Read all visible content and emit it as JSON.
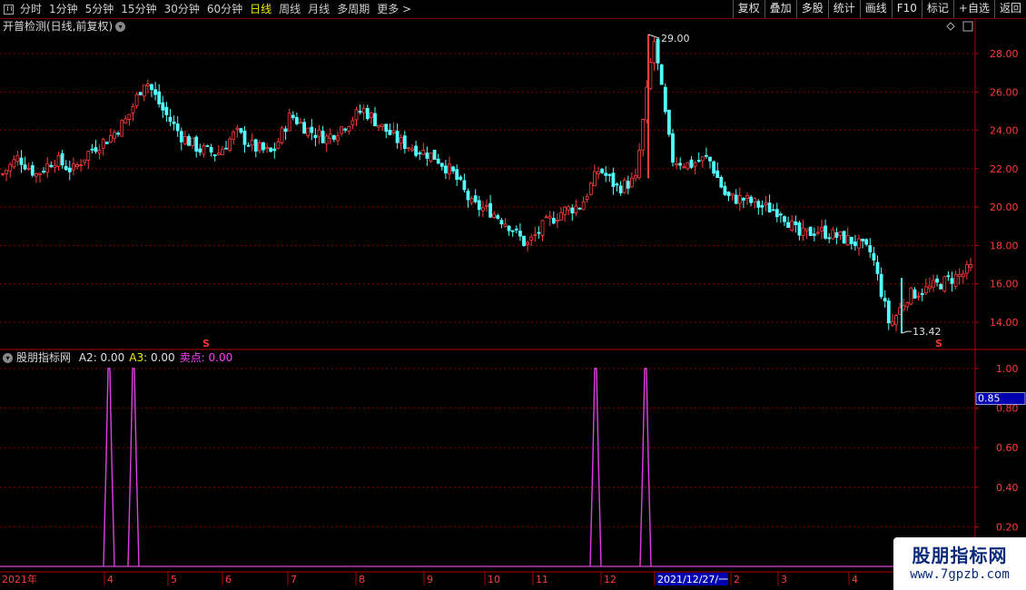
{
  "toolbar": {
    "periods": [
      "分时",
      "1分钟",
      "5分钟",
      "15分钟",
      "30分钟",
      "60分钟",
      "日线",
      "周线",
      "月线",
      "多周期",
      "更多"
    ],
    "active_period": "日线",
    "right_buttons": [
      "复权",
      "叠加",
      "多股",
      "统计",
      "画线",
      "F10",
      "标记",
      "+自选",
      "返回"
    ]
  },
  "main_panel": {
    "title": "开普检测(日线,前复权)",
    "high_label": "29.00",
    "low_label": "13.42",
    "sell_marker": "S",
    "y_ticks": [
      "28.00",
      "26.00",
      "24.00",
      "22.00",
      "20.00",
      "18.00",
      "16.00",
      "14.00"
    ]
  },
  "indicator_panel": {
    "name": "股朋指标网",
    "fields": [
      {
        "label": "A2:",
        "value": "0.00",
        "color": "#e0e0e0"
      },
      {
        "label": "A3:",
        "value": "0.00",
        "color": "#f0f000"
      },
      {
        "label": "卖点:",
        "value": "0.00",
        "color": "#ff40ff"
      }
    ],
    "y_ticks": [
      "1.00",
      "0.80",
      "0.60",
      "0.40",
      "0.20"
    ],
    "cursor_value": "0.85"
  },
  "time_axis": {
    "labels": [
      "2021年",
      "4",
      "5",
      "6",
      "7",
      "8",
      "9",
      "10",
      "11",
      "12",
      "2021/12/27/一",
      "2",
      "3",
      "4"
    ]
  },
  "colors": {
    "up": "#ff3c3c",
    "down": "#54ffff",
    "grid": "#8b0000",
    "indicator_line": "#e040e0"
  },
  "chart_data": {
    "type": "line",
    "y_range_price": [
      13.0,
      29.0
    ],
    "price_high": 29.0,
    "price_low": 13.42,
    "indicator_ylim": [
      0,
      1
    ],
    "x": [
      0,
      20,
      40,
      60,
      80,
      100,
      120,
      140,
      160,
      180,
      200,
      220,
      240,
      260,
      280,
      300,
      320,
      340,
      360,
      380,
      400,
      420,
      440,
      460,
      480,
      500,
      520,
      540,
      560,
      580,
      600,
      620,
      640,
      660,
      680,
      700,
      720,
      740,
      760,
      780,
      800,
      820,
      840,
      860,
      880,
      900,
      920,
      940,
      960,
      980,
      1000,
      1020,
      1040,
      1060,
      1075
    ],
    "series": [
      {
        "values": [
          21.6,
          22.6,
          21.7,
          22.5,
          21.9,
          23.0,
          23.6,
          24.6,
          26.7,
          25.0,
          23.7,
          23.0,
          22.8,
          23.9,
          23.1,
          22.8,
          24.8,
          24.0,
          23.6,
          24.3,
          25.1,
          24.2,
          23.4,
          23.0,
          22.6,
          21.7,
          20.1,
          19.8,
          19.1,
          18.0,
          19.1,
          19.8,
          20.1,
          22.0,
          21.0,
          21.4,
          28.8,
          22.5,
          22.2,
          22.6,
          20.5,
          20.4,
          20.0,
          19.8,
          18.5,
          18.8,
          18.5,
          18.2,
          17.6,
          13.8,
          15.4,
          15.7,
          16.1,
          16.5,
          17.0
        ]
      },
      {
        "values": [
          0,
          0,
          0,
          0,
          0,
          0,
          1,
          0,
          0,
          0,
          0,
          0,
          0,
          0,
          0,
          0,
          0,
          0,
          0,
          0,
          0,
          0,
          0,
          0,
          0,
          0,
          0,
          0,
          0,
          0,
          0,
          0,
          0,
          1,
          0,
          0,
          1,
          0,
          0,
          0,
          0,
          0,
          0,
          0,
          0,
          0,
          0,
          0,
          0,
          0,
          0,
          0,
          0,
          0,
          0
        ]
      }
    ]
  }
}
